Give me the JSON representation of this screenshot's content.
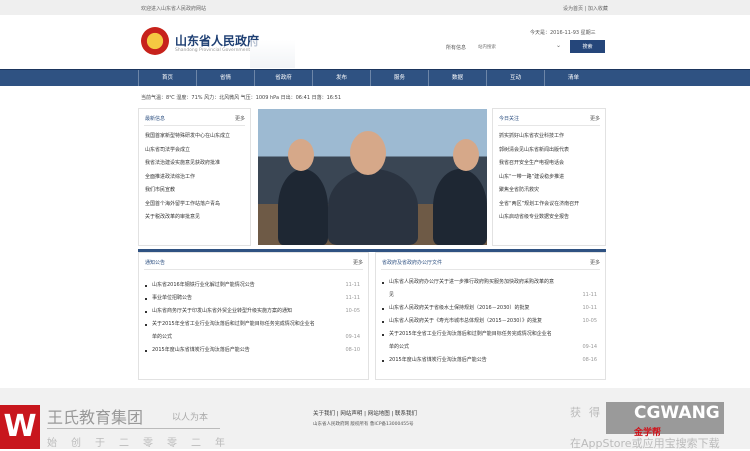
{
  "topbar": {
    "welcome": "欢迎进入山东省人民政府网站",
    "links": "设为首页 | 加入收藏"
  },
  "header": {
    "title": "山东省人民政府",
    "subtitle": "Shandong Provincial Government",
    "date": "今天是：2016-11-93  星期三",
    "search_label": "所有信息",
    "search_placeholder": "站内搜索",
    "search_button": "搜索"
  },
  "nav": [
    "首页",
    "省情",
    "省政府",
    "发布",
    "服务",
    "数据",
    "互动",
    "清单"
  ],
  "weather": "当前气温：8℃  湿度：71%  风力：北风微风  气压：1009 hPa  日出：06:41  日落：16:51",
  "left_box": {
    "title": "最新信息",
    "more": "更多",
    "items": [
      "我国首家新型特殊研发中心在山东成立",
      "山东省司法学会成立",
      "我省法治建设实施意见获政府批准",
      "全面推进政法综治工作",
      "我们市民宣教",
      "全国首个海外留学工作站落户青岛",
      "关于税改改革的审批意见"
    ]
  },
  "right_box": {
    "title": "今日关注",
    "more": "更多",
    "items": [
      "抓实抓好山东省农业科技工作",
      "郭树清会见山东省新闻出版代表",
      "我省召开安全生产电视电话会",
      "山东“一带一路”建设稳步推进",
      "聚焦全省防汛救灾",
      "全省“两区”规划工作会议在济南召开",
      "山东启动省级专业数据安全报告"
    ]
  },
  "notice": {
    "title": "通知公告",
    "more": "更多",
    "items": [
      {
        "text": "山东省2016年钢铁行业化解过剩产能情况公告",
        "date": "11-11"
      },
      {
        "text": "事业单位招聘公告",
        "date": "11-11"
      },
      {
        "text": "山东省商务厅关于印发山东省外贸企业转型升级实施方案的通知",
        "date": "10-05"
      },
      {
        "text": "关于2015年全省工业行业淘汰落后和过剩产能目标任务完成情况和企业名",
        "date": ""
      },
      {
        "text": "单的公式",
        "date": "09-14"
      },
      {
        "text": "2015年度山东省煤炭行业淘汰落后产能公告",
        "date": "08-10"
      }
    ]
  },
  "docs": {
    "title": "省政府及省政府办公厅文件",
    "more": "更多",
    "items": [
      {
        "text": "山东省人民政府办公厅关于进一步推行政府购买服务加快政府采购改革的意",
        "date": ""
      },
      {
        "text": "见",
        "date": "11-11"
      },
      {
        "text": "山东省人民政府关于省级水土保持规划（2016－2030）的批复",
        "date": "10-11"
      },
      {
        "text": "山东省人民政府关于《寿光市城市总体规划（2015－2030）》的批复",
        "date": "10-05"
      },
      {
        "text": "关于2015年全省工业行业淘汰落后和过剩产能目标任务完成情况和企业名",
        "date": ""
      },
      {
        "text": "单的公式",
        "date": "09-14"
      },
      {
        "text": "2015年度山东省煤炭行业淘汰落后产能公告",
        "date": "08-16"
      }
    ]
  },
  "footer": {
    "links": "关于我们 | 网站声明 | 网站地图 | 联系我们",
    "copyright": "山东省人民政府网  版权所有      鲁ICP备13000455号"
  },
  "watermark": {
    "name": "王氏教育集团",
    "slogan": "以人为本",
    "sub": "始创于二零零二年",
    "right": "获得更多资料",
    "brand": "CGWANG",
    "brand_cn": "金学帮",
    "app": "在AppStore或应用宝搜索下载"
  }
}
